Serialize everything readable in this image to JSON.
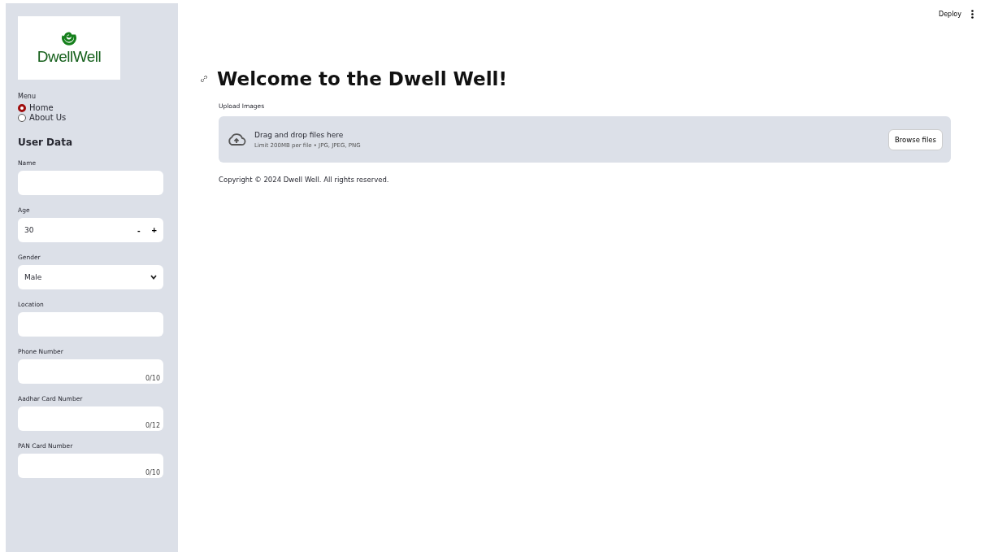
{
  "sidebar": {
    "logo_text": "DwellWell",
    "menu": {
      "label": "Menu",
      "options": [
        {
          "label": "Home",
          "selected": true
        },
        {
          "label": "About Us",
          "selected": false
        }
      ]
    },
    "section_title": "User Data",
    "fields": [
      {
        "kind": "text",
        "label": "Name"
      },
      {
        "kind": "number",
        "label": "Age",
        "value": "30",
        "minus": "-",
        "plus": "+"
      },
      {
        "kind": "select",
        "label": "Gender",
        "value": "Male"
      },
      {
        "kind": "text",
        "label": "Location"
      },
      {
        "kind": "text",
        "label": "Phone Number",
        "counter": "0/10"
      },
      {
        "kind": "text",
        "label": "Aadhar Card Number",
        "counter": "0/12"
      },
      {
        "kind": "text",
        "label": "PAN Card Number",
        "counter": "0/10"
      }
    ]
  },
  "toolbar": {
    "deploy": "Deploy"
  },
  "main": {
    "title": "Welcome to the Dwell Well!",
    "uploader": {
      "label": "Upload Images",
      "instruction": "Drag and drop files here",
      "limit": "Limit 200MB per file • JPG, JPEG, PNG",
      "button": "Browse files"
    },
    "footer": "Copyright © 2024 Dwell Well. All rights reserved."
  }
}
